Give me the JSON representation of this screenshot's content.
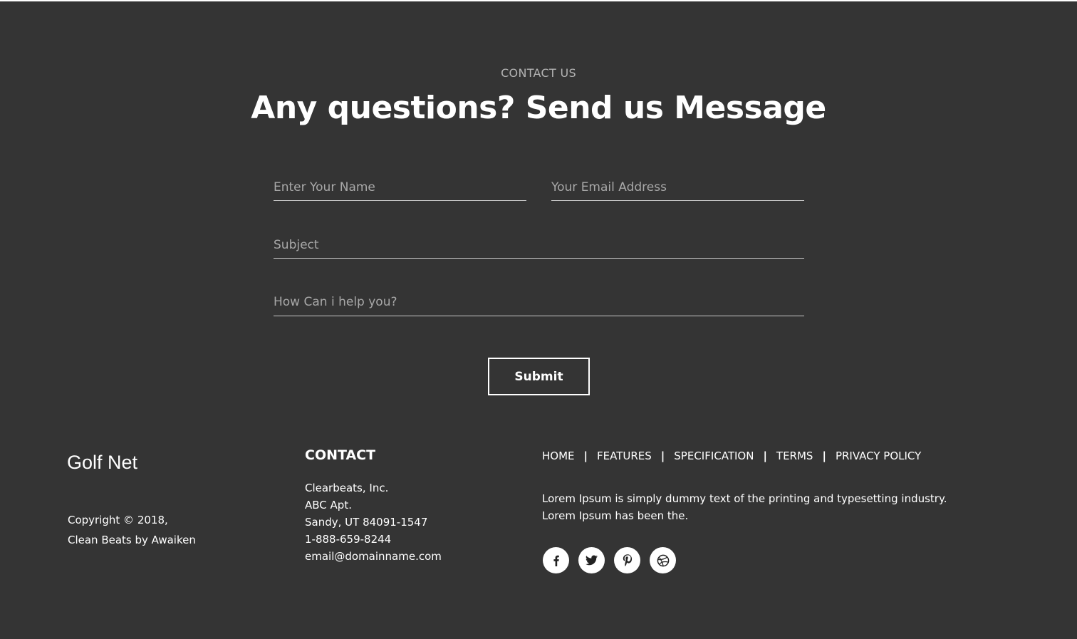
{
  "contact_section": {
    "eyebrow": "CONTACT US",
    "headline": "Any questions? Send us Message",
    "form": {
      "name_placeholder": "Enter Your Name",
      "email_placeholder": "Your Email Address",
      "subject_placeholder": "Subject",
      "message_placeholder": "How Can i help you?",
      "submit_label": "Submit"
    }
  },
  "footer": {
    "brand": "Golf Net",
    "copyright_line1": "Copyright © 2018,",
    "copyright_line2": "Clean Beats by Awaiken",
    "contact": {
      "title": "CONTACT",
      "company": "Clearbeats, Inc.",
      "address1": "ABC Apt.",
      "address2": "Sandy, UT 84091-1547",
      "phone": "1-888-659-8244",
      "email": "email@domainname.com"
    },
    "nav": {
      "items": [
        "HOME",
        "FEATURES",
        "SPECIFICATION",
        "TERMS",
        "PRIVACY POLICY"
      ],
      "separator": "|"
    },
    "about_line1": "Lorem Ipsum is simply dummy text of the printing and typesetting industry.",
    "about_line2": "Lorem Ipsum has been the.",
    "social_icons": [
      "facebook-icon",
      "twitter-icon",
      "pinterest-icon",
      "dribbble-icon"
    ]
  },
  "colors": {
    "background": "#343434",
    "text": "#ffffff",
    "muted_text": "#b3b3b3",
    "placeholder": "#a8a8a8",
    "input_underline": "#c8c8c8"
  }
}
